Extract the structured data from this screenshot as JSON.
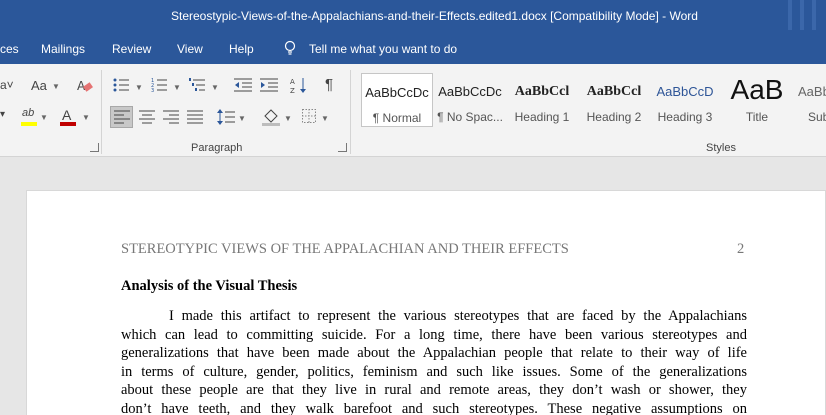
{
  "window": {
    "title": "Stereostypic-Views-of-the-Appalachians-and-their-Effects.edited1.docx [Compatibility Mode]  -  Word"
  },
  "menu": {
    "tabs": [
      "ces",
      "Mailings",
      "Review",
      "View",
      "Help"
    ],
    "tell_me": "Tell me what you want to do"
  },
  "ribbon": {
    "font_group": {
      "change_case": "Aa",
      "highlight": "ab",
      "font_color": "A"
    },
    "paragraph_group": {
      "label": "Paragraph",
      "pilcrow": "¶"
    },
    "styles_group": {
      "label": "Styles",
      "styles": [
        {
          "preview": "AaBbCcDc",
          "label": "¶ Normal",
          "selected": true
        },
        {
          "preview": "AaBbCcDc",
          "label": "¶ No Spac..."
        },
        {
          "preview": "AaBbCcl",
          "label": "Heading 1"
        },
        {
          "preview": "AaBbCcl",
          "label": "Heading 2"
        },
        {
          "preview": "AaBbCcD",
          "label": "Heading 3"
        },
        {
          "preview": "AaB",
          "label": "Title"
        },
        {
          "preview": "AaBb",
          "label": "Sub"
        }
      ]
    },
    "colors": {
      "highlight": "#ffff00",
      "font_color": "#c00000"
    }
  },
  "document": {
    "running_head": "STEREOTYPIC VIEWS OF THE APPALACHIAN AND THEIR EFFECTS",
    "page_number": "2",
    "heading": "Analysis of the Visual Thesis",
    "lines": [
      "I made this artifact to represent the various stereotypes that are faced by the Appalachians",
      "which can lead to committing suicide. For a long time, there have been various stereotypes and",
      "generalizations that have been made about the Appalachian people that relate to their way of life",
      "in terms of culture, gender, politics, feminism and such like issues. Some of the generalizations",
      "about these people are that they live in rural and remote areas, they don’t wash or shower, they",
      "don’t have teeth, and they walk barefoot and such stereotypes. These negative assumptions on"
    ]
  },
  "colors": {
    "word_blue": "#2b579a",
    "ribbon_bg": "#f3f3f3",
    "doc_bg": "#e6e6e6"
  }
}
